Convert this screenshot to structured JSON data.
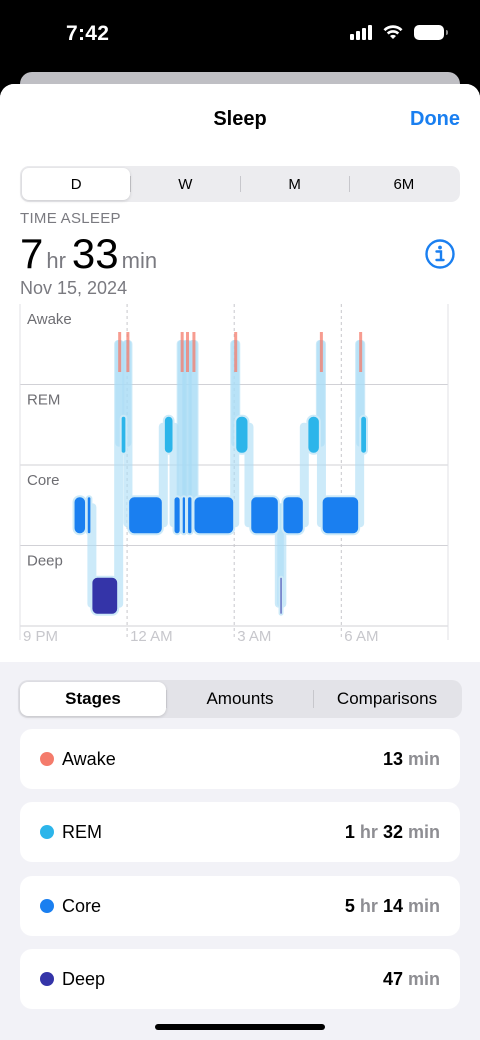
{
  "status": {
    "time": "7:42"
  },
  "nav": {
    "title": "Sleep",
    "done": "Done"
  },
  "range_tabs": [
    "D",
    "W",
    "M",
    "6M"
  ],
  "range_selected": "D",
  "metric": {
    "label": "TIME ASLEEP",
    "hours": "7",
    "hours_unit": "hr",
    "minutes": "33",
    "minutes_unit": "min",
    "date": "Nov 15, 2024"
  },
  "chart_data": {
    "type": "bar",
    "rows": [
      "Awake",
      "REM",
      "Core",
      "Deep"
    ],
    "x_ticks": [
      "9 PM",
      "12 AM",
      "3 AM",
      "6 AM"
    ],
    "x_unit": "hours after 9 PM",
    "segments": [
      {
        "stage": "Core",
        "start": 1.5,
        "end": 1.85
      },
      {
        "stage": "Core",
        "start": 1.87,
        "end": 2.0
      },
      {
        "stage": "Deep",
        "start": 2.0,
        "end": 2.75
      },
      {
        "stage": "Awake",
        "start": 2.75,
        "end": 2.78
      },
      {
        "stage": "REM",
        "start": 2.82,
        "end": 2.98
      },
      {
        "stage": "Awake",
        "start": 2.98,
        "end": 3.01
      },
      {
        "stage": "Core",
        "start": 3.03,
        "end": 4.0
      },
      {
        "stage": "REM",
        "start": 4.03,
        "end": 4.3
      },
      {
        "stage": "Core",
        "start": 4.3,
        "end": 4.5
      },
      {
        "stage": "Awake",
        "start": 4.5,
        "end": 4.53
      },
      {
        "stage": "Core",
        "start": 4.53,
        "end": 4.65
      },
      {
        "stage": "Awake",
        "start": 4.65,
        "end": 4.68
      },
      {
        "stage": "Core",
        "start": 4.68,
        "end": 4.83
      },
      {
        "stage": "Awake",
        "start": 4.83,
        "end": 4.86
      },
      {
        "stage": "Core",
        "start": 4.86,
        "end": 6.0
      },
      {
        "stage": "Awake",
        "start": 6.0,
        "end": 6.03
      },
      {
        "stage": "REM",
        "start": 6.03,
        "end": 6.4
      },
      {
        "stage": "Core",
        "start": 6.45,
        "end": 7.25
      },
      {
        "stage": "Deep",
        "start": 7.27,
        "end": 7.32
      },
      {
        "stage": "Core",
        "start": 7.35,
        "end": 7.95
      },
      {
        "stage": "REM",
        "start": 8.05,
        "end": 8.4
      },
      {
        "stage": "Awake",
        "start": 8.4,
        "end": 8.43
      },
      {
        "stage": "Core",
        "start": 8.45,
        "end": 9.5
      },
      {
        "stage": "Awake",
        "start": 9.5,
        "end": 9.53
      },
      {
        "stage": "REM",
        "start": 9.53,
        "end": 9.72
      }
    ]
  },
  "view_tabs": [
    "Stages",
    "Amounts",
    "Comparisons"
  ],
  "view_selected": "Stages",
  "stages": [
    {
      "name": "Awake",
      "color": "#f47b6b",
      "h": "",
      "h_unit": "",
      "m": "13",
      "m_unit": "min"
    },
    {
      "name": "REM",
      "color": "#2cb5ea",
      "h": "1",
      "h_unit": "hr",
      "m": "32",
      "m_unit": "min"
    },
    {
      "name": "Core",
      "color": "#1a7ff0",
      "h": "5",
      "h_unit": "hr",
      "m": "14",
      "m_unit": "min"
    },
    {
      "name": "Deep",
      "color": "#3434a8",
      "h": "",
      "h_unit": "",
      "m": "47",
      "m_unit": "min"
    }
  ],
  "colors": {
    "accent": "#1a7ff0",
    "awake": "#f47b6b",
    "rem": "#2cb5ea",
    "core": "#1a7ff0",
    "deep": "#3434a8"
  },
  "icons": {
    "info": "info-circle-icon",
    "signal": "cellular-signal-icon",
    "wifi": "wifi-icon",
    "battery": "battery-icon"
  }
}
